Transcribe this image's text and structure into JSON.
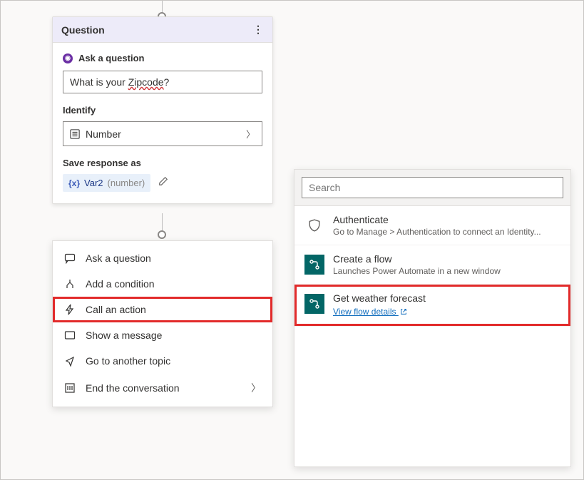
{
  "question_node": {
    "header": "Question",
    "ask_label": "Ask a question",
    "question_text_prefix": "What is your ",
    "question_text_wavy": "Zipcode",
    "question_text_suffix": "?",
    "identify_label": "Identify",
    "identify_value": "Number",
    "save_label": "Save response as",
    "var_name": "Var2",
    "var_type": "(number)"
  },
  "action_menu": {
    "items": [
      {
        "icon": "chat",
        "label": "Ask a question"
      },
      {
        "icon": "branch",
        "label": "Add a condition"
      },
      {
        "icon": "lightning",
        "label": "Call an action",
        "highlighted": true
      },
      {
        "icon": "message",
        "label": "Show a message"
      },
      {
        "icon": "share",
        "label": "Go to another topic"
      },
      {
        "icon": "end",
        "label": "End the conversation",
        "arrow": true
      }
    ]
  },
  "right_panel": {
    "search_placeholder": "Search",
    "items": [
      {
        "icon": "shield",
        "title": "Authenticate",
        "subtitle": "Go to Manage > Authentication to connect an Identity..."
      },
      {
        "icon": "flow",
        "title": "Create a flow",
        "subtitle": "Launches Power Automate in a new window"
      },
      {
        "icon": "flow",
        "title": "Get weather forecast",
        "link_text": "View flow details",
        "highlighted": true
      }
    ]
  }
}
